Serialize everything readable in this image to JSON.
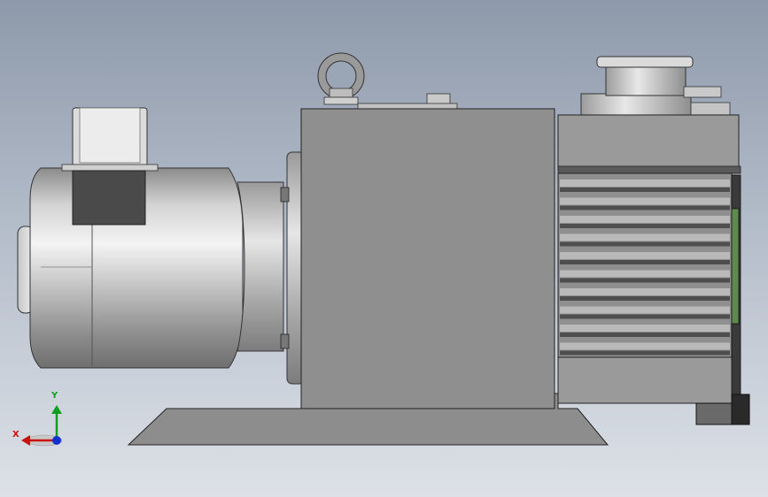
{
  "viewport": {
    "background_top": "#8e99aa",
    "background_bottom": "#dde1e7"
  },
  "model": {
    "name": "",
    "components": [
      "motor-housing",
      "terminal-box",
      "coupling-flange",
      "pump-body",
      "lifting-eye",
      "cooling-fins",
      "exhaust-cap",
      "base-plate",
      "gas-ballast-knob"
    ]
  },
  "triad": {
    "x_label": "X",
    "y_label": "Y",
    "x_color": "#cc1010",
    "y_color": "#10a020",
    "z_color": "#1030d0"
  }
}
